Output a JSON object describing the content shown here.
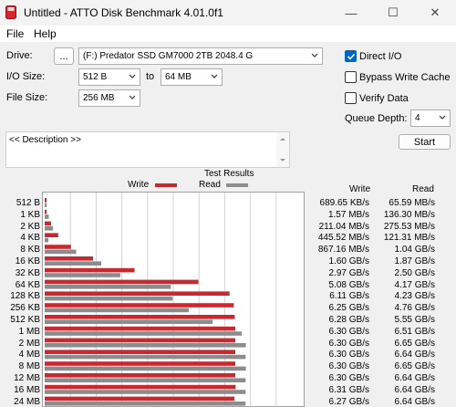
{
  "window": {
    "title": "Untitled - ATTO Disk Benchmark 4.01.0f1",
    "minimize_glyph": "—",
    "maximize_glyph": "☐",
    "close_glyph": "✕"
  },
  "menu": {
    "file": "File",
    "help": "Help"
  },
  "controls": {
    "drive_label": "Drive:",
    "browse_label": "...",
    "drive_value": "(F:) Predator SSD GM7000 2TB 2048.4 G",
    "io_label": "I/O Size:",
    "io_from": "512 B",
    "io_to_label": "to",
    "io_to": "64 MB",
    "file_label": "File Size:",
    "file_value": "256 MB",
    "direct_io": {
      "label": "Direct I/O",
      "checked": true
    },
    "bypass_cache": {
      "label": "Bypass Write Cache",
      "checked": false
    },
    "verify": {
      "label": "Verify Data",
      "checked": false
    },
    "queue_label": "Queue Depth:",
    "queue_value": "4",
    "start_label": "Start",
    "description": "<< Description >>"
  },
  "results": {
    "title": "Test Results",
    "write_legend": "Write",
    "read_legend": "Read",
    "write_header": "Write",
    "read_header": "Read",
    "colors": {
      "write": "#c8282f",
      "read": "#8c8c8c"
    }
  },
  "chart_data": {
    "type": "bar",
    "orientation": "horizontal",
    "categories": [
      "512 B",
      "1 KB",
      "2 KB",
      "4 KB",
      "8 KB",
      "16 KB",
      "32 KB",
      "64 KB",
      "128 KB",
      "256 KB",
      "512 KB",
      "1 MB",
      "2 MB",
      "4 MB",
      "8 MB",
      "12 MB",
      "16 MB",
      "24 MB"
    ],
    "write_text": [
      "689.65 KB/s",
      "1.57 MB/s",
      "211.04 MB/s",
      "445.52 MB/s",
      "867.16 MB/s",
      "1.60 GB/s",
      "2.97 GB/s",
      "5.08 GB/s",
      "6.11 GB/s",
      "6.25 GB/s",
      "6.28 GB/s",
      "6.30 GB/s",
      "6.30 GB/s",
      "6.30 GB/s",
      "6.30 GB/s",
      "6.30 GB/s",
      "6.31 GB/s",
      "6.27 GB/s"
    ],
    "read_text": [
      "65.59 MB/s",
      "136.30 MB/s",
      "275.53 MB/s",
      "121.31 MB/s",
      "1.04 GB/s",
      "1.87 GB/s",
      "2.50 GB/s",
      "4.17 GB/s",
      "4.23 GB/s",
      "4.76 GB/s",
      "5.55 GB/s",
      "6.51 GB/s",
      "6.65 GB/s",
      "6.64 GB/s",
      "6.65 GB/s",
      "6.64 GB/s",
      "6.64 GB/s",
      "6.64 GB/s"
    ],
    "series": [
      {
        "name": "Write",
        "unit": "GB/s",
        "values": [
          0.0007,
          0.0016,
          0.211,
          0.446,
          0.867,
          1.6,
          2.97,
          5.08,
          6.11,
          6.25,
          6.28,
          6.3,
          6.3,
          6.3,
          6.3,
          6.3,
          6.31,
          6.27
        ]
      },
      {
        "name": "Read",
        "unit": "GB/s",
        "values": [
          0.066,
          0.136,
          0.276,
          0.121,
          1.04,
          1.87,
          2.5,
          4.17,
          4.23,
          4.76,
          5.55,
          6.51,
          6.65,
          6.64,
          6.65,
          6.64,
          6.64,
          6.64
        ]
      }
    ],
    "xlim": [
      0,
      8.5
    ],
    "grid": true
  }
}
